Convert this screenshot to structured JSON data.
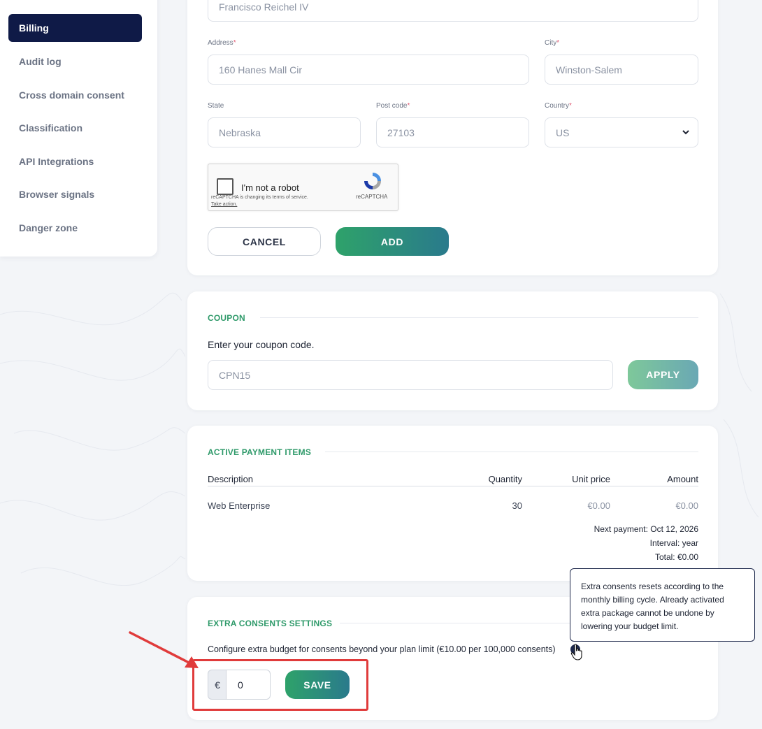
{
  "sidebar": {
    "items": [
      {
        "label": "Billing",
        "active": true
      },
      {
        "label": "Audit log"
      },
      {
        "label": "Cross domain consent"
      },
      {
        "label": "Classification"
      },
      {
        "label": "API Integrations"
      },
      {
        "label": "Browser signals"
      },
      {
        "label": "Danger zone"
      }
    ]
  },
  "billing_form": {
    "name_value": "Francisco Reichel IV",
    "address_label": "Address",
    "address_value": "160 Hanes Mall Cir",
    "city_label": "City",
    "city_value": "Winston-Salem",
    "state_label": "State",
    "state_value": "Nebraska",
    "postcode_label": "Post code",
    "postcode_value": "27103",
    "country_label": "Country",
    "country_value": "US",
    "required_mark": "*",
    "recaptcha": {
      "label": "I'm not a robot",
      "note": "reCAPTCHA is changing its terms of service.",
      "link": "Take action.",
      "brand": "reCAPTCHA"
    },
    "cancel_label": "CANCEL",
    "add_label": "ADD"
  },
  "coupon": {
    "title": "COUPON",
    "prompt": "Enter your coupon code.",
    "placeholder": "CPN15",
    "apply_label": "APPLY"
  },
  "payment_items": {
    "title": "ACTIVE PAYMENT ITEMS",
    "headers": {
      "description": "Description",
      "quantity": "Quantity",
      "unit_price": "Unit price",
      "amount": "Amount"
    },
    "rows": [
      {
        "description": "Web Enterprise",
        "quantity": "30",
        "unit_price": "€0.00",
        "amount": "€0.00"
      }
    ],
    "next_payment": "Next payment: Oct 12, 2026",
    "interval": "Interval: year",
    "total": "Total: €0.00"
  },
  "extra_consents": {
    "title": "EXTRA CONSENTS SETTINGS",
    "description": "Configure extra budget for consents beyond your plan limit (€10.00 per 100,000 consents)",
    "currency": "€",
    "budget_value": "0",
    "save_label": "SAVE",
    "tooltip": "Extra consents resets according to the monthly billing cycle. Already activated extra package cannot be undone by lowering your budget limit."
  },
  "colors": {
    "accent_green": "#2f9a6a",
    "nav_active": "#0f1a47",
    "highlight_red": "#e03b3b"
  }
}
